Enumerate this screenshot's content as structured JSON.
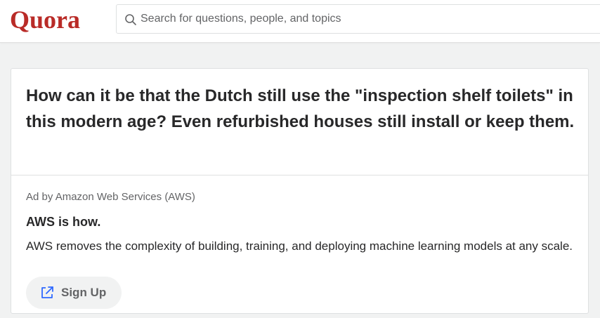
{
  "header": {
    "logo_text": "Quora",
    "search": {
      "placeholder": "Search for questions, people, and topics",
      "icon": "search-icon"
    }
  },
  "question": {
    "title": "How can it be that the Dutch still use the \"inspection shelf toilets\" in this modern age? Even refurbished houses still install or keep them."
  },
  "ad": {
    "label": "Ad by Amazon Web Services (AWS)",
    "title": "AWS is how.",
    "body": "AWS removes the complexity of building, training, and deploying machine learning models at any scale.",
    "cta": {
      "label": "Sign Up",
      "icon": "external-link-icon"
    }
  },
  "colors": {
    "brand": "#b92b27",
    "link_blue": "#2e69ff",
    "text_primary": "#282829",
    "text_secondary": "#636466",
    "page_background": "#f1f2f2"
  }
}
